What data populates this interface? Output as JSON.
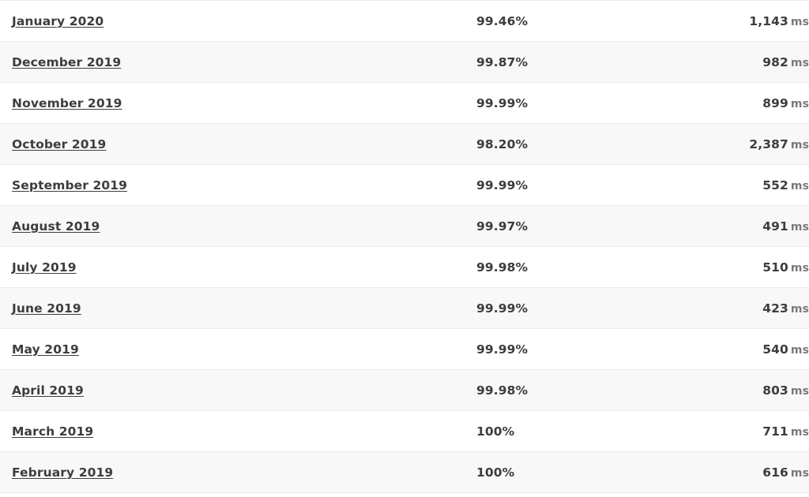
{
  "table": {
    "units": {
      "response_time_unit": "ms"
    },
    "colors": {
      "text": "#3d3d3d",
      "unit_text": "#7a7a7a",
      "row_odd_bg": "#ffffff",
      "row_even_bg": "#f8f8f8",
      "row_border": "#ececec"
    },
    "rows": [
      {
        "month": "January 2020",
        "uptime": "99.46%",
        "response_time": "1,143",
        "unit": "ms"
      },
      {
        "month": "December 2019",
        "uptime": "99.87%",
        "response_time": "982",
        "unit": "ms"
      },
      {
        "month": "November 2019",
        "uptime": "99.99%",
        "response_time": "899",
        "unit": "ms"
      },
      {
        "month": "October 2019",
        "uptime": "98.20%",
        "response_time": "2,387",
        "unit": "ms"
      },
      {
        "month": "September 2019",
        "uptime": "99.99%",
        "response_time": "552",
        "unit": "ms"
      },
      {
        "month": "August 2019",
        "uptime": "99.97%",
        "response_time": "491",
        "unit": "ms"
      },
      {
        "month": "July 2019",
        "uptime": "99.98%",
        "response_time": "510",
        "unit": "ms"
      },
      {
        "month": "June 2019",
        "uptime": "99.99%",
        "response_time": "423",
        "unit": "ms"
      },
      {
        "month": "May 2019",
        "uptime": "99.99%",
        "response_time": "540",
        "unit": "ms"
      },
      {
        "month": "April 2019",
        "uptime": "99.98%",
        "response_time": "803",
        "unit": "ms"
      },
      {
        "month": "March 2019",
        "uptime": "100%",
        "response_time": "711",
        "unit": "ms"
      },
      {
        "month": "February 2019",
        "uptime": "100%",
        "response_time": "616",
        "unit": "ms"
      }
    ]
  }
}
